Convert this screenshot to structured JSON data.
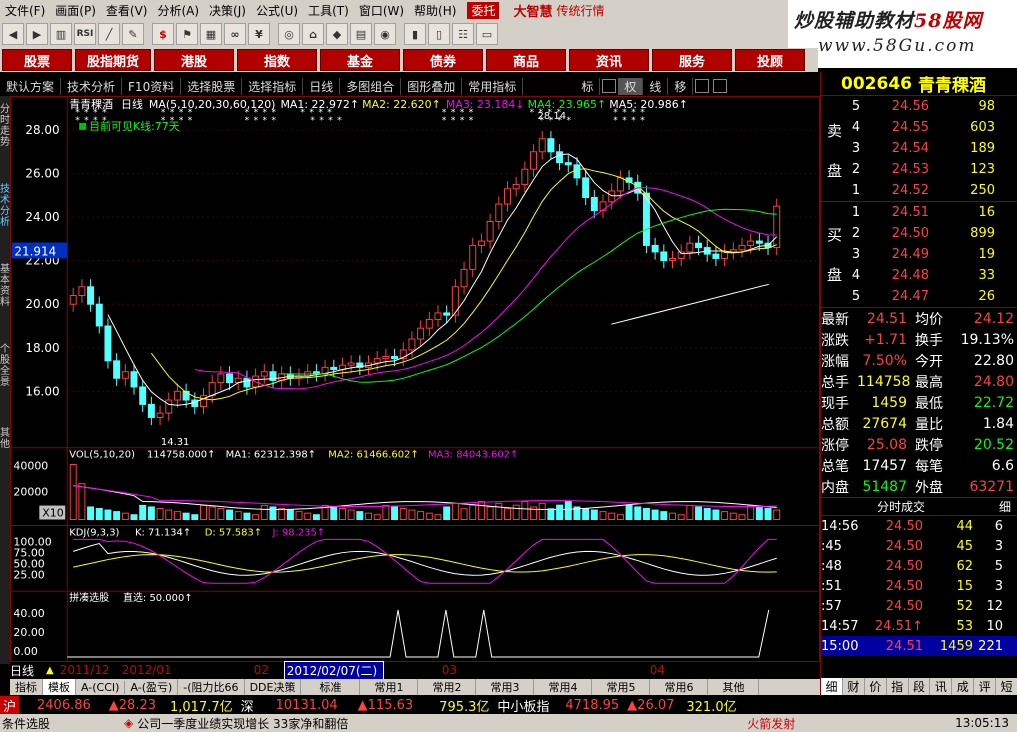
{
  "menu": [
    "文件(F)",
    "画面(P)",
    "查看(V)",
    "分析(A)",
    "决策(J)",
    "公式(U)",
    "工具(T)",
    "窗口(W)",
    "帮助(H)"
  ],
  "menu_special": "委托",
  "brand": "大智慧",
  "brand_sub": "传统行情",
  "banner": {
    "line1_a": "炒股辅助教材",
    "line1_b": "58股网",
    "line2": "www.58Gu.com"
  },
  "nav": [
    "股票",
    "股指期货",
    "港股",
    "指数",
    "基金",
    "债券",
    "商品",
    "资讯",
    "服务",
    "投顾"
  ],
  "subbar": [
    "默认方案",
    "技术分析",
    "F10资料",
    "选择股票",
    "选择指标",
    "日线",
    "多图组合",
    "图形叠加",
    "常用指标"
  ],
  "subbar_right": [
    "标",
    "权",
    "线",
    "移"
  ],
  "left_side_1": "分时走势",
  "left_side_2": "技术分析",
  "left_side_3": "基本资料",
  "left_side_4": "个股全景",
  "left_side_5": "其他",
  "stock": {
    "code": "002646",
    "name": "青青稞酒"
  },
  "chart_header": {
    "name": "青青稞酒",
    "period": "日线",
    "ma_label": "MA(5,10,20,30,60,120)",
    "ma1": "MA1: 22.972↑",
    "ma2": "MA2: 22.620↑",
    "ma3": "MA3: 23.184↓",
    "ma4": "MA4: 23.965↑",
    "ma5": "MA5: 20.986↑",
    "visible": "目前可见K线:77天",
    "price_label": "21.914",
    "high_label": "28.14",
    "low_label": "14.31"
  },
  "vol_header": {
    "label": "VOL(5,10,20)",
    "v": "114758.000↑",
    "ma1": "MA1: 62312.398↑",
    "ma2": "MA2: 61466.602↑",
    "ma3": "MA3: 84043.602↑"
  },
  "vol_scale": "X10",
  "kdj_header": {
    "label": "KDJ(9,3,3)",
    "k": "K: 71.134↑",
    "d": "D: 57.583↑",
    "j": "J: 98.235↑"
  },
  "sel_header": {
    "label": "拼凑选股",
    "v": "直选: 50.000↑"
  },
  "orderbook": {
    "sell_label": [
      "卖",
      "盘"
    ],
    "buy_label": [
      "买",
      "盘"
    ],
    "sell": [
      {
        "n": "5",
        "p": "24.56",
        "v": "98"
      },
      {
        "n": "4",
        "p": "24.55",
        "v": "603"
      },
      {
        "n": "3",
        "p": "24.54",
        "v": "189"
      },
      {
        "n": "2",
        "p": "24.53",
        "v": "123"
      },
      {
        "n": "1",
        "p": "24.52",
        "v": "250"
      }
    ],
    "buy": [
      {
        "n": "1",
        "p": "24.51",
        "v": "16"
      },
      {
        "n": "2",
        "p": "24.50",
        "v": "899"
      },
      {
        "n": "3",
        "p": "24.49",
        "v": "19"
      },
      {
        "n": "4",
        "p": "24.48",
        "v": "33"
      },
      {
        "n": "5",
        "p": "24.47",
        "v": "26"
      }
    ]
  },
  "quote": [
    {
      "k": "最新",
      "v1": "24.51",
      "c1": "red",
      "k2": "均价",
      "v2": "24.12",
      "c2": "red"
    },
    {
      "k": "涨跌",
      "v1": "+1.71",
      "c1": "red",
      "k2": "换手",
      "v2": "19.13%",
      "c2": "wht"
    },
    {
      "k": "涨幅",
      "v1": "7.50%",
      "c1": "red",
      "k2": "今开",
      "v2": "22.80",
      "c2": "wht"
    },
    {
      "k": "总手",
      "v1": "114758",
      "c1": "yel",
      "k2": "最高",
      "v2": "24.80",
      "c2": "red"
    },
    {
      "k": "现手",
      "v1": "1459",
      "c1": "yel",
      "k2": "最低",
      "v2": "22.72",
      "c2": "grn"
    },
    {
      "k": "总额",
      "v1": "27674",
      "c1": "yel",
      "k2": "量比",
      "v2": "1.84",
      "c2": "wht"
    },
    {
      "k": "涨停",
      "v1": "25.08",
      "c1": "red",
      "k2": "跌停",
      "v2": "20.52",
      "c2": "grn"
    },
    {
      "k": "总笔",
      "v1": "17457",
      "c1": "wht",
      "k2": "每笔",
      "v2": "6.6",
      "c2": "wht"
    },
    {
      "k": "内盘",
      "v1": "51487",
      "c1": "grn",
      "k2": "外盘",
      "v2": "63271",
      "c2": "red"
    }
  ],
  "ticks_title": "分时成交",
  "ticks_right": "细",
  "ticks": [
    {
      "t": "14:56",
      "p": "24.50",
      "v": "44",
      "c": "6"
    },
    {
      "t": ":45",
      "p": "24.50",
      "v": "45",
      "c": "3"
    },
    {
      "t": ":48",
      "p": "24.50",
      "v": "62",
      "c": "5"
    },
    {
      "t": ":51",
      "p": "24.50",
      "v": "15",
      "c": "3"
    },
    {
      "t": ":57",
      "p": "24.50",
      "v": "52",
      "c": "12"
    },
    {
      "t": "14:57",
      "p": "24.51↑",
      "v": "53",
      "c": "10"
    },
    {
      "t": "15:00",
      "p": "24.51",
      "v": "1459",
      "c": "221"
    }
  ],
  "rp_tabs": [
    "细",
    "财",
    "价",
    "指",
    "段",
    "讯",
    "成",
    "评",
    "短"
  ],
  "dates": {
    "period": "日线",
    "d1": "2011/12",
    "d2": "2012/01",
    "d3": "02",
    "d4": "2012/02/07(二)",
    "d5": "03",
    "d6": "04"
  },
  "tabs": [
    "指标",
    "模板",
    "A-(CCI)",
    "A-(盈亏)",
    "-(阻力比66",
    "DDE决策",
    "标准",
    "常用1",
    "常用2",
    "常用3",
    "常用4",
    "常用5",
    "常用6",
    "其他"
  ],
  "ticker": {
    "sh": "沪",
    "sh_v": "2406.86",
    "sh_c": "28.23",
    "sh_amt": "1,017.7亿",
    "sz": "深",
    "sz_v": "10131.04",
    "sz_c": "115.63",
    "sz_amt": "795.3亿",
    "zx": "中小板指",
    "zx_v": "4718.95",
    "zx_c": "26.07",
    "zx_amt": "321.0亿"
  },
  "status": {
    "left": "条件选股",
    "news": "公司一季度业绩实现增长 33家净和翻倍",
    "alert": "火箭发射",
    "time": "13:05:13"
  }
}
